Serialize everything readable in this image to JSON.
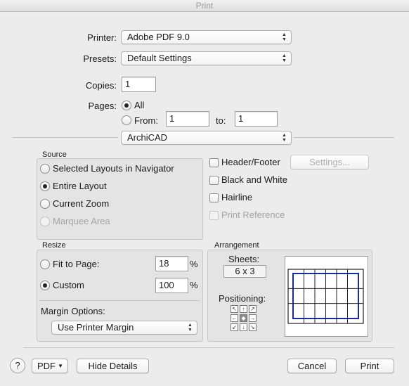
{
  "window": {
    "title": "Print"
  },
  "printer": {
    "label": "Printer:",
    "value": "Adobe PDF 9.0"
  },
  "presets": {
    "label": "Presets:",
    "value": "Default Settings"
  },
  "copies": {
    "label": "Copies:",
    "value": "1"
  },
  "pages": {
    "label": "Pages:",
    "all_label": "All",
    "from_label": "From:",
    "from_value": "1",
    "to_label": "to:",
    "to_value": "1",
    "selected": "All"
  },
  "section_popup": {
    "value": "ArchiCAD"
  },
  "source": {
    "title": "Source",
    "options": [
      {
        "label": "Selected Layouts in Navigator",
        "selected": false,
        "enabled": true
      },
      {
        "label": "Entire Layout",
        "selected": true,
        "enabled": true
      },
      {
        "label": "Current Zoom",
        "selected": false,
        "enabled": true
      },
      {
        "label": "Marquee Area",
        "selected": false,
        "enabled": false
      }
    ]
  },
  "options": {
    "header_footer": "Header/Footer",
    "settings_button": "Settings...",
    "black_white": "Black and White",
    "hairline": "Hairline",
    "print_reference": "Print Reference"
  },
  "resize": {
    "title": "Resize",
    "fit_to_page_label": "Fit to Page:",
    "fit_to_page_value": "18",
    "custom_label": "Custom",
    "custom_value": "100",
    "percent": "%",
    "selected": "Custom",
    "margin_options_label": "Margin Options:",
    "margin_value": "Use Printer Margin"
  },
  "arrangement": {
    "title": "Arrangement",
    "sheets_label": "Sheets:",
    "sheets_value": "6 x 3",
    "positioning_label": "Positioning:",
    "preview_columns": 6,
    "preview_rows": 3
  },
  "footer": {
    "help": "?",
    "pdf_button": "PDF",
    "hide_details": "Hide Details",
    "cancel": "Cancel",
    "print": "Print"
  }
}
